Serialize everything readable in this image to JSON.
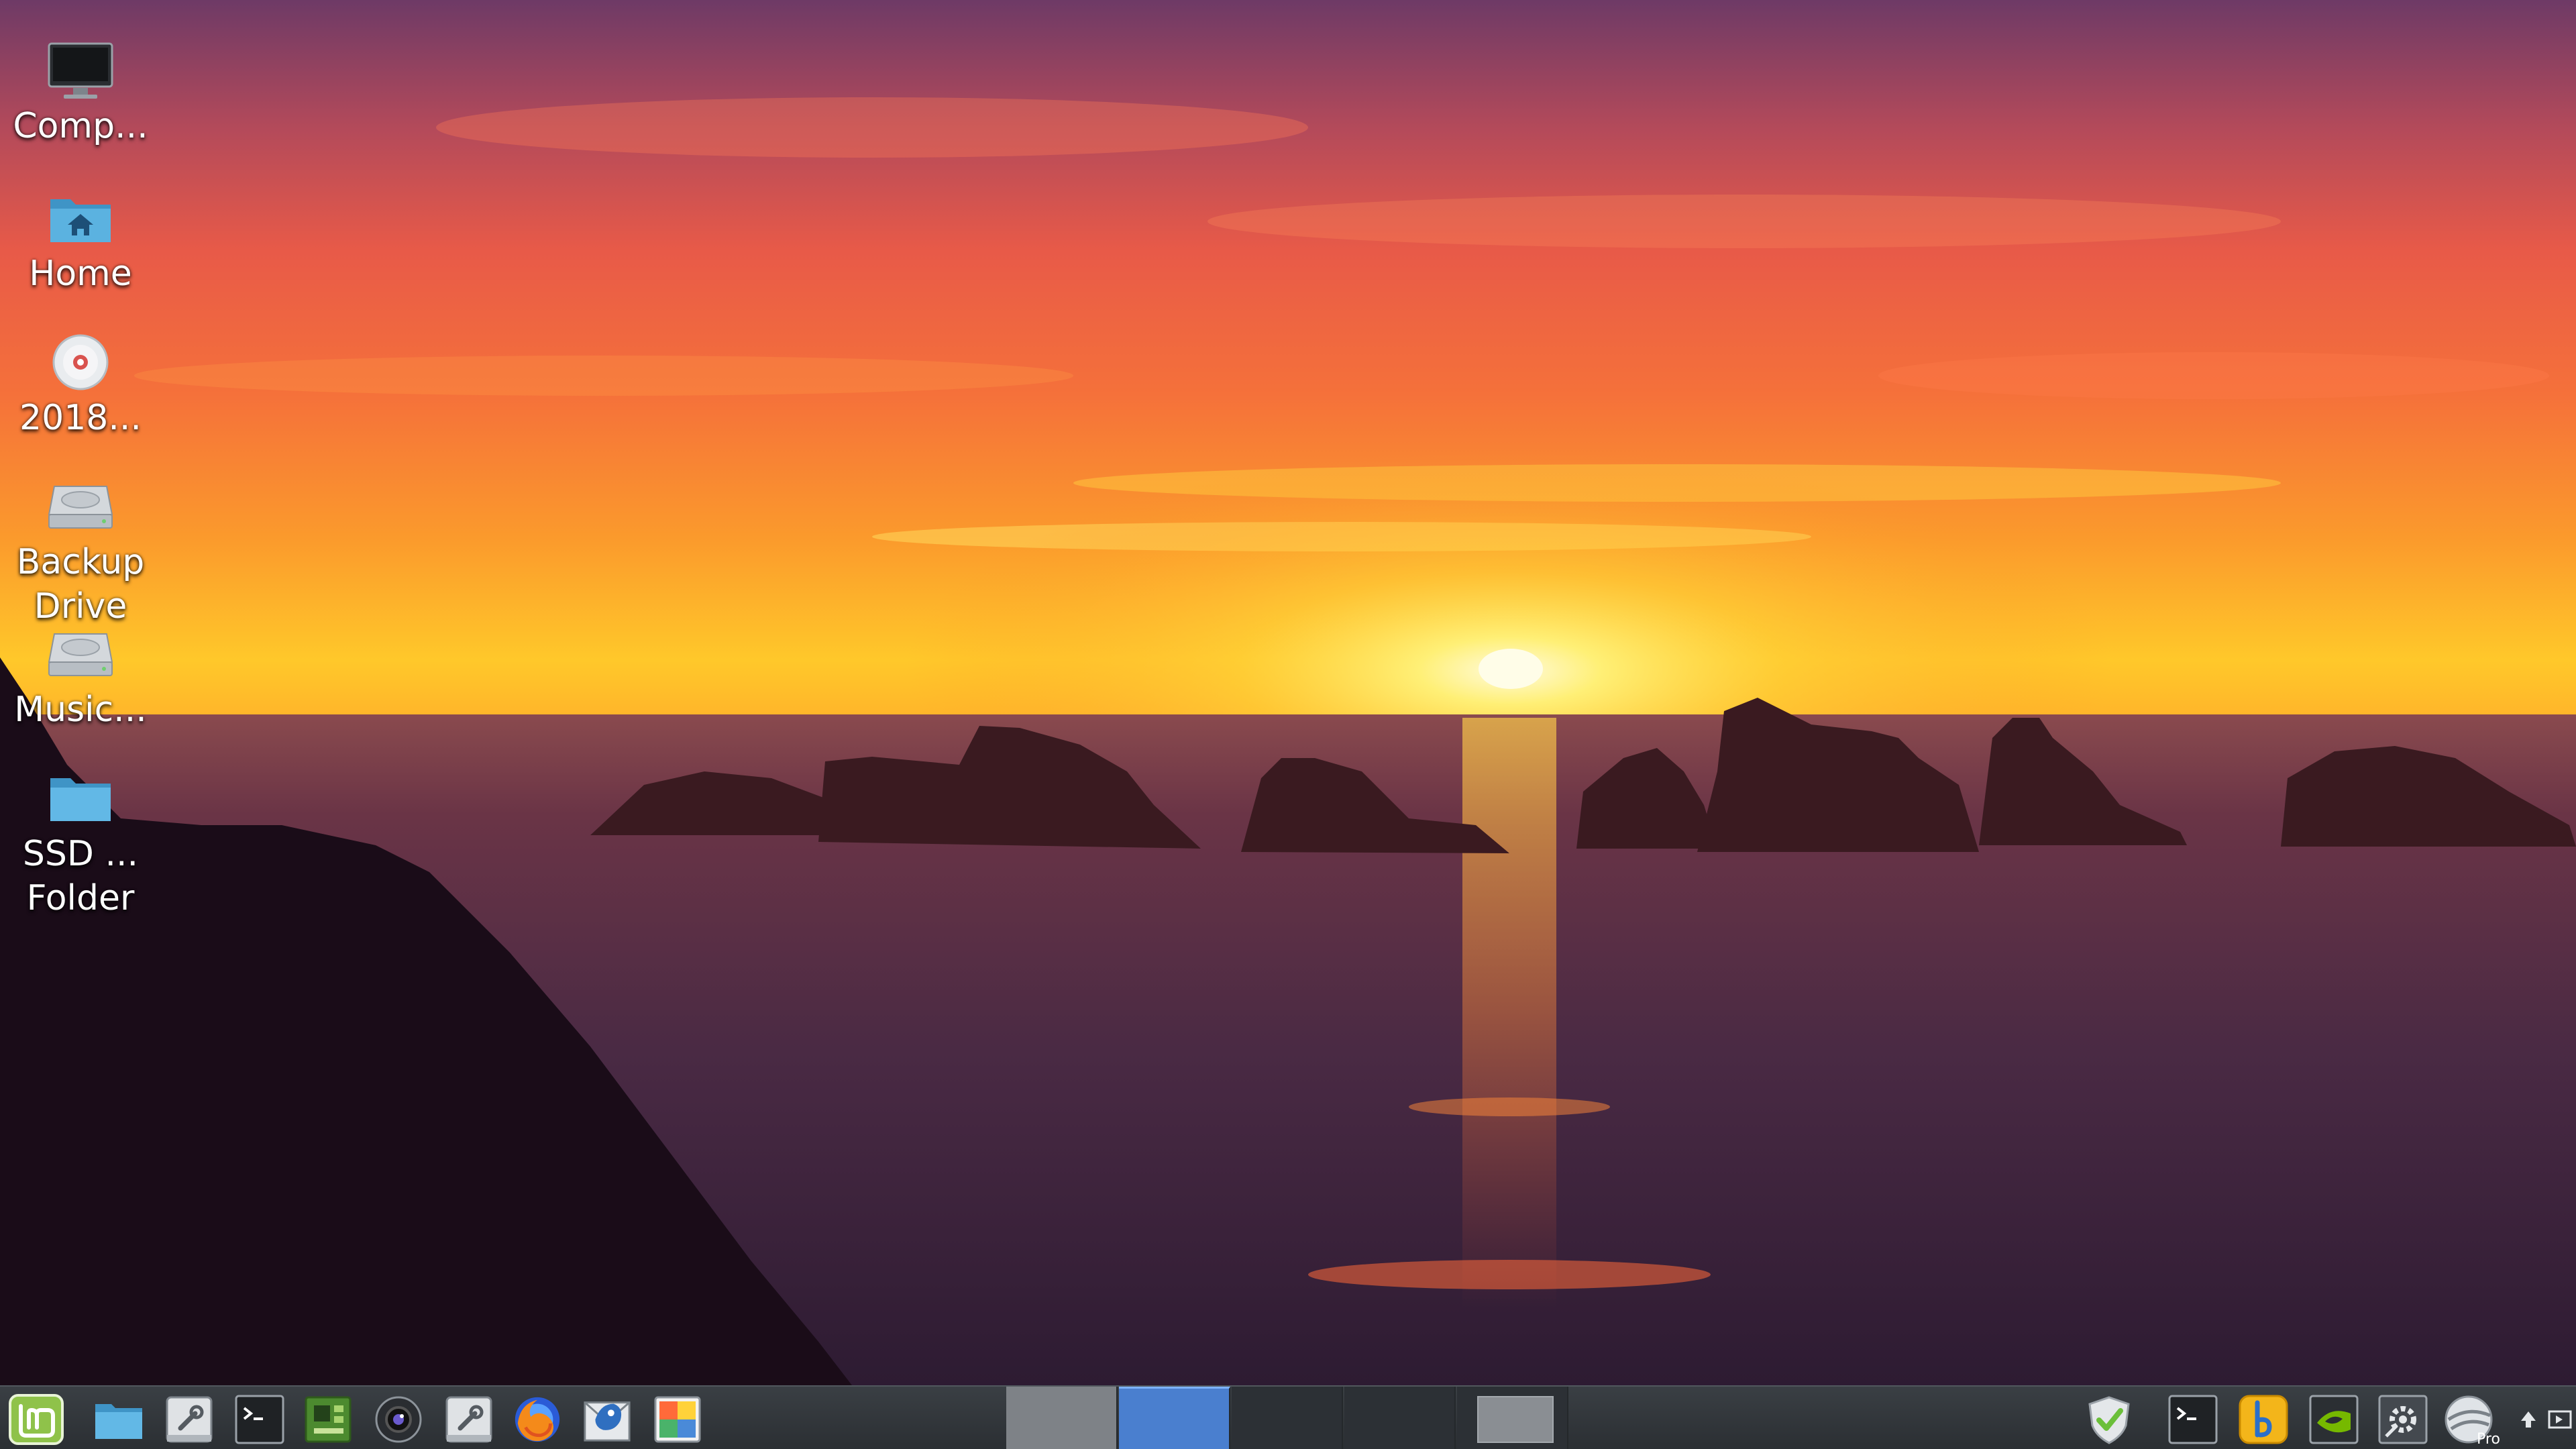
{
  "desktop": {
    "icons": [
      {
        "label": "Comp...",
        "icon": "computer-icon"
      },
      {
        "label": "Home",
        "icon": "home-folder-icon"
      },
      {
        "label": "2018...",
        "icon": "optical-disc-icon"
      },
      {
        "label": "Backup\nDrive",
        "icon": "hard-drive-icon"
      },
      {
        "label": "Music...",
        "icon": "hard-drive-icon"
      },
      {
        "label": "SSD ...\nFolder",
        "icon": "folder-icon"
      }
    ]
  },
  "panel": {
    "menu_icon": "linux-mint-menu-icon",
    "launchers": [
      "file-manager-icon",
      "system-settings-icon",
      "terminal-icon",
      "system-monitor-icon",
      "webcam-icon",
      "tools-icon",
      "firefox-icon",
      "thunderbird-icon",
      "image-viewer-icon"
    ],
    "workspaces": {
      "count": 5,
      "active_index": 1
    },
    "tray": [
      "update-manager-shield-icon",
      "terminal-icon",
      "bluetooth-icon",
      "nvidia-icon",
      "settings-tools-icon",
      "google-earth-pro-icon",
      "notification-arrow-icon",
      "show-desktop-icon"
    ],
    "tray_badge": "Pro"
  },
  "colors": {
    "panel_bg": "#2f3337",
    "workspace_active": "#4a7fcf",
    "sky_top": "#7a3a63",
    "sun": "#fff7c2",
    "sea": "#3a2340"
  }
}
